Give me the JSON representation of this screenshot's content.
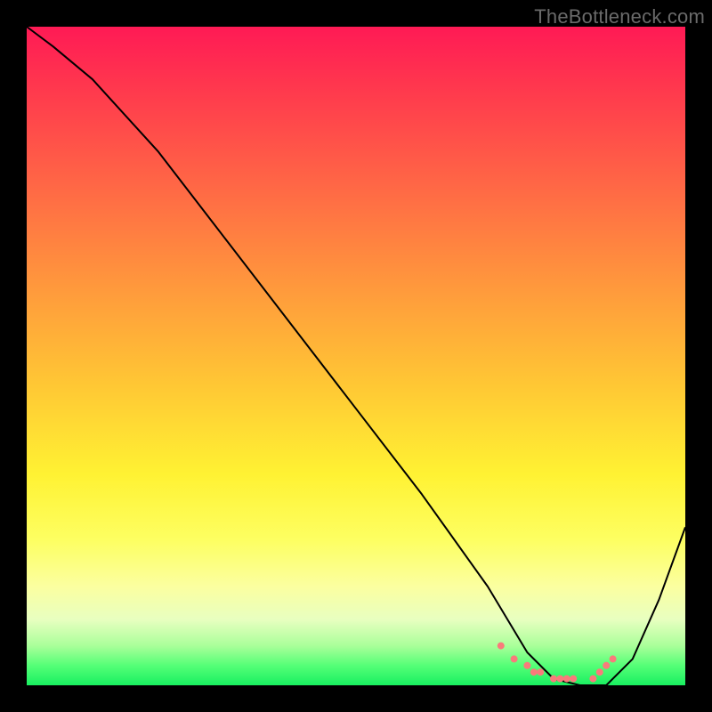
{
  "watermark": "TheBottleneck.com",
  "chart_data": {
    "type": "line",
    "title": "",
    "xlabel": "",
    "ylabel": "",
    "xlim": [
      0,
      100
    ],
    "ylim": [
      0,
      100
    ],
    "series": [
      {
        "name": "curve",
        "x": [
          0,
          4,
          10,
          20,
          30,
          40,
          50,
          60,
          70,
          76,
          80,
          84,
          88,
          92,
          96,
          100
        ],
        "y": [
          100,
          97,
          92,
          81,
          68,
          55,
          42,
          29,
          15,
          5,
          1,
          0,
          0,
          4,
          13,
          24
        ]
      }
    ],
    "markers": {
      "comment": "pink dots along the bottom valley of the curve",
      "x": [
        72,
        74,
        76,
        77,
        78,
        80,
        81,
        82,
        83,
        86,
        87,
        88,
        89
      ],
      "y": [
        6,
        4,
        3,
        2,
        2,
        1,
        1,
        1,
        1,
        1,
        2,
        3,
        4
      ],
      "color": "#f97b7b",
      "size": 8
    },
    "colors": {
      "line": "#000000",
      "gradient_top": "#ff1a55",
      "gradient_bottom": "#18ef60"
    }
  }
}
